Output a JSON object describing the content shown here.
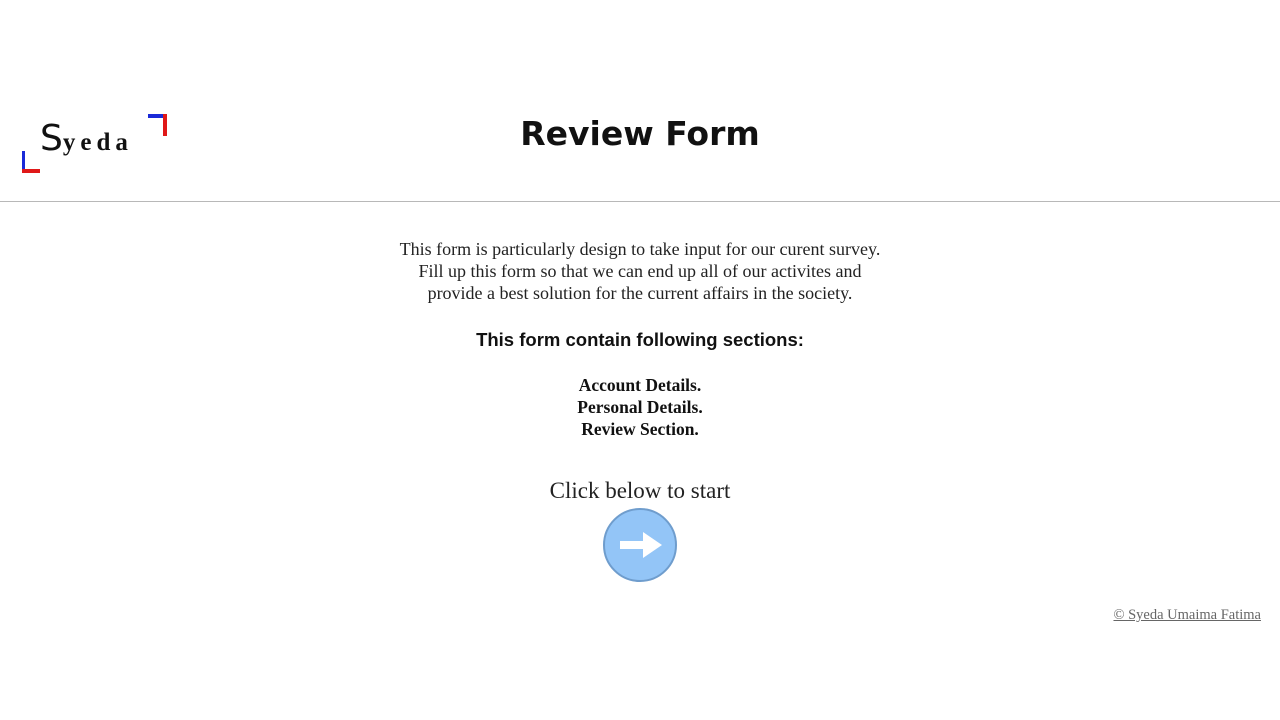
{
  "header": {
    "logo": {
      "first_letter": "S",
      "rest": "yeda"
    },
    "title": "Review Form"
  },
  "intro": {
    "lines": [
      "This form is particularly design to take input for our curent survey.",
      "Fill up this form so that we can end up all of our activites and",
      "provide a best solution for the current affairs in the society."
    ]
  },
  "sections": {
    "heading": "This form contain following sections:",
    "items": [
      "Account Details.",
      "Personal Details.",
      "Review Section."
    ]
  },
  "start": {
    "prompt": "Click below to start",
    "button_icon": "right-arrow-icon",
    "button_color": "#93c5f7"
  },
  "footer": {
    "copyright": "© Syeda Umaima Fatima"
  },
  "colors": {
    "logo_red": "#e01818",
    "logo_blue": "#1a2ad8",
    "divider": "#b8b8b8"
  }
}
